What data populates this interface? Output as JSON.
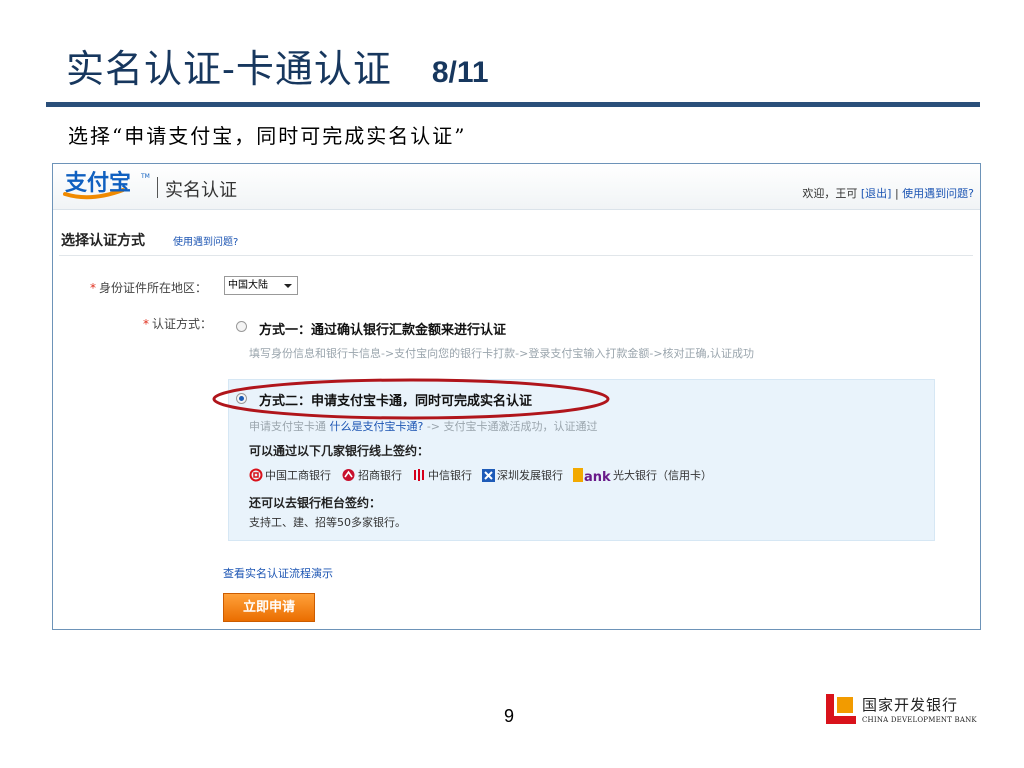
{
  "slide": {
    "title": "实名认证-卡通认证",
    "page_fraction": "8/11",
    "subtitle": "选择“申请支付宝，同时可完成实名认证”",
    "page_number": "9"
  },
  "app": {
    "logo_text": "支付宝",
    "section_name": "实名认证",
    "welcome": "欢迎，王可 ",
    "logout_link": "[退出]",
    "separator": " | ",
    "help_link": "使用遇到问题?"
  },
  "form": {
    "section_title": "选择认证方式",
    "section_help": "使用遇到问题?",
    "region_label": "身份证件所在地区：",
    "region_value": "中国大陆",
    "method_label": "认证方式：",
    "required_mark": "*",
    "option1": {
      "title": "方式一：通过确认银行汇款金额来进行认证",
      "description": "填写身份信息和银行卡信息->支付宝向您的银行卡打款->登录支付宝输入打款金额->核对正确,认证成功",
      "selected": false
    },
    "option2": {
      "title": "方式二：申请支付宝卡通，同时可完成实名认证",
      "status_prefix": "申请支付宝卡通 ",
      "status_link": "什么是支付宝卡通?",
      "status_suffix": " -> 支付宝卡通激活成功，认证通过",
      "banks_heading": "可以通过以下几家银行线上签约：",
      "banks": [
        {
          "name": "中国工商银行",
          "icon": "icbc-icon",
          "color": "#d9121b"
        },
        {
          "name": "招商银行",
          "icon": "cmb-icon",
          "color": "#c8102e"
        },
        {
          "name": "中信银行",
          "icon": "citic-icon",
          "color": "#d6001c"
        },
        {
          "name": "深圳发展银行",
          "icon": "sdb-icon",
          "color": "#1e5bb8"
        },
        {
          "name": "光大银行（信用卡）",
          "icon": "ceb-icon",
          "color": "#f2a900",
          "logo_text": "ank"
        }
      ],
      "counter_heading": "还可以去银行柜台签约：",
      "counter_desc": "支持工、建、招等50多家银行。",
      "selected": true
    },
    "flow_link": "查看实名认证流程演示",
    "apply_button": "立即申请"
  },
  "footer": {
    "bank_name_cn": "国家开发银行",
    "bank_name_en": "CHINA DEVELOPMENT BANK"
  },
  "colors": {
    "title": "#17375e",
    "rule": "#2a4f7a",
    "link": "#1c55b3",
    "highlight": "#b0151b",
    "button": "#ea6d00"
  }
}
